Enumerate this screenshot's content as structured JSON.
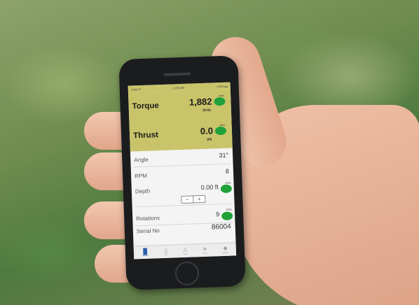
{
  "status_bar": {
    "carrier": "••ooo ✉",
    "time": "11:55 AM",
    "battery": "▪ 61% ▬"
  },
  "metrics": [
    {
      "label": "Torque",
      "value": "1,882",
      "unit": "(ft-lb)",
      "tag": "ZERO"
    },
    {
      "label": "Thrust",
      "value": "0.0",
      "unit": "(M)",
      "tag": "ZERO"
    }
  ],
  "rows": {
    "angle": {
      "label": "Angle",
      "value": "31°"
    },
    "rpm": {
      "label": "RPM",
      "value": "8"
    },
    "depth": {
      "label": "Depth",
      "value": "0.00 ft",
      "tag": "ZERO",
      "minus": "−",
      "plus": "+"
    },
    "rotations": {
      "label": "Rotations",
      "value": "9",
      "tag": "ZERO"
    },
    "serial": {
      "label": "Serial No",
      "value": "86004"
    }
  },
  "tabs": [
    {
      "icon": "▐▌",
      "label": "Monitor",
      "active": true
    },
    {
      "icon": "▯",
      "label": "Logs"
    },
    {
      "icon": "⚠",
      "label": "Alerts"
    },
    {
      "icon": "✈",
      "label": "Tools"
    },
    {
      "icon": "✹",
      "label": "Settings"
    }
  ],
  "colors": {
    "header_yellow": "#c9c46a",
    "zero_green": "#1fa23a",
    "active_tab": "#2a5aa8"
  }
}
